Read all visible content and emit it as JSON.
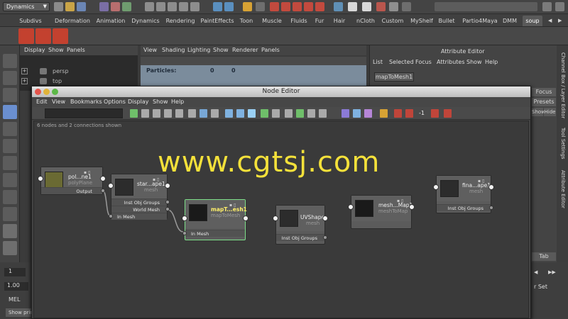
{
  "status": {
    "mode": "Dynamics"
  },
  "shelf_tabs": [
    "Subdivs",
    "Deformation",
    "Animation",
    "Dynamics",
    "Rendering",
    "PaintEffects",
    "Toon",
    "Muscle",
    "Fluids",
    "Fur",
    "Hair",
    "nCloth",
    "Custom",
    "MyShelf",
    "Bullet",
    "Partio4Maya",
    "DMM",
    "soup"
  ],
  "panel_menu": [
    "Display",
    "Show",
    "Panels"
  ],
  "viewport_menu": [
    "View",
    "Shading",
    "Lighting",
    "Show",
    "Renderer",
    "Panels"
  ],
  "outliner": {
    "items": [
      "persp",
      "top"
    ]
  },
  "viewport": {
    "particles_label": "Particles:",
    "particles_a": "0",
    "particles_b": "0"
  },
  "attr_editor": {
    "title": "Attribute Editor",
    "menu": [
      "List",
      "Selected",
      "Focus",
      "Attributes",
      "Show",
      "Help"
    ],
    "tab": "mapToMesh1",
    "focus_button": "Focus",
    "presets_button": "Presets",
    "show_button": "Show",
    "hide_button": "Hide",
    "tab_label": "Tab"
  },
  "right_strip": [
    "Channel Box / Layer Editor",
    "Tool Settings",
    "Attribute Editor"
  ],
  "bottom": {
    "frame": "1",
    "value": "1.00",
    "mel_label": "MEL",
    "status_text": "Show prin",
    "setkey": "r Set"
  },
  "node_editor": {
    "title": "Node Editor",
    "menu": [
      "Edit",
      "View",
      "Bookmarks",
      "Options",
      "Display",
      "Show",
      "Help"
    ],
    "toolbar_value": "-1",
    "info": "6 nodes and 2 connections shown",
    "nodes": [
      {
        "name": "pol...ne1",
        "type": "polyPlane",
        "attrs": [
          "Output"
        ]
      },
      {
        "name": "star...ape1",
        "type": "mesh",
        "attrs": [
          "Inst Obj Groups",
          "World Mesh",
          "In Mesh"
        ]
      },
      {
        "name": "mapT...esh1",
        "type": "mapToMesh",
        "attrs": [
          "In Mesh"
        ]
      },
      {
        "name": "UVShape",
        "type": "mesh",
        "attrs": [
          "Inst Obj Groups"
        ]
      },
      {
        "name": "mesh...Map1",
        "type": "meshToMap",
        "attrs": []
      },
      {
        "name": "fina...ape1",
        "type": "mesh",
        "attrs": [
          "Inst Obj Groups"
        ]
      }
    ]
  },
  "watermark": "www.cgtsj.com",
  "colors": {
    "selected_node": "#7ee08a",
    "watermark": "#f4e13a",
    "viewport": "#7b8c9c"
  }
}
